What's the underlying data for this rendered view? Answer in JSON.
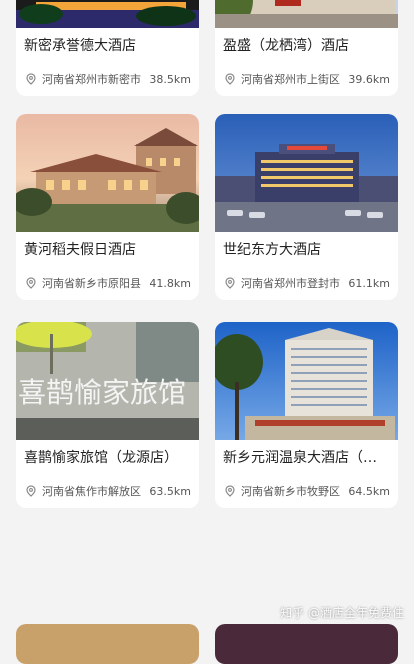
{
  "hotels": [
    {
      "name": "新密承誉德大酒店",
      "address": "河南省郑州市新密市",
      "distance": "38.5km"
    },
    {
      "name": "盈盛（龙栖湾）酒店",
      "address": "河南省郑州市上街区",
      "distance": "39.6km"
    },
    {
      "name": "黄河稻夫假日酒店",
      "address": "河南省新乡市原阳县",
      "distance": "41.8km"
    },
    {
      "name": "世纪东方大酒店",
      "address": "河南省郑州市登封市",
      "distance": "61.1km"
    },
    {
      "name": "喜鹊愉家旅馆（龙源店）",
      "address": "河南省焦作市解放区",
      "distance": "63.5km"
    },
    {
      "name": "新乡元润温泉大酒店（牧野店）",
      "address": "河南省新乡市牧野区",
      "distance": "64.5km"
    }
  ],
  "photo_signs": {
    "shop_sign": "喜鹊愉家旅馆"
  },
  "icons": {
    "location": "location-pin-icon"
  },
  "watermark": "知乎 @酒店全年免费住"
}
